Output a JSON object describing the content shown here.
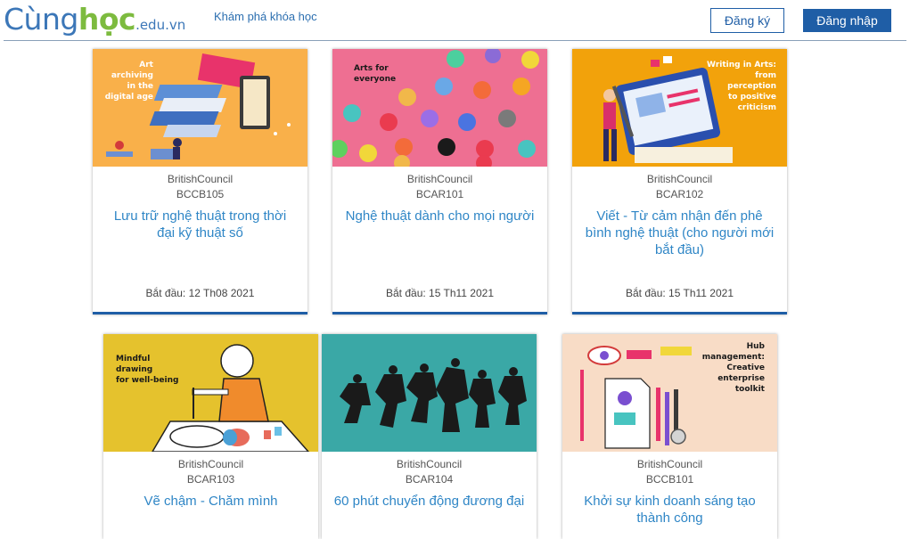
{
  "header": {
    "logo": {
      "part1": "Cùng",
      "part2": "học",
      "part3": ".edu.vn"
    },
    "nav_explore": "Khám phá khóa học",
    "register": "Đăng ký",
    "login": "Đăng nhập"
  },
  "colors": {
    "brand_blue": "#1f5ea6",
    "logo_green": "#7dbb3f",
    "title_blue": "#2f86c6"
  },
  "courses": [
    {
      "org": "BritishCouncil",
      "code": "BCCB105",
      "title": "Lưu trữ nghệ thuật trong thời đại kỹ thuật số",
      "start": "Bắt đầu: 12 Th08 2021",
      "thumb_text": [
        "Art",
        "archiving",
        "in the",
        "digital age"
      ]
    },
    {
      "org": "BritishCouncil",
      "code": "BCAR101",
      "title": "Nghệ thuật dành cho mọi người",
      "start": "Bắt đầu: 15 Th11 2021",
      "thumb_text": [
        "Arts for",
        "everyone"
      ]
    },
    {
      "org": "BritishCouncil",
      "code": "BCAR102",
      "title": "Viết - Từ cảm nhận đến phê bình nghệ thuật (cho người mới bắt đầu)",
      "start": "Bắt đầu: 15 Th11 2021",
      "thumb_text": [
        "Writing in Arts:",
        "from",
        "perception",
        "to positive",
        "criticism"
      ]
    },
    {
      "org": "BritishCouncil",
      "code": "BCAR103",
      "title": "Vẽ chậm - Chăm mình",
      "thumb_text": [
        "Mindful",
        "drawing",
        "for well-being"
      ]
    },
    {
      "org": "BritishCouncil",
      "code": "BCAR104",
      "title": "60 phút chuyển động đương đại"
    },
    {
      "org": "BritishCouncil",
      "code": "BCCB101",
      "title": "Khởi sự kinh doanh sáng tạo thành công",
      "thumb_text": [
        "Hub",
        "management:",
        "Creative",
        "enterprise",
        "toolkit"
      ]
    }
  ]
}
